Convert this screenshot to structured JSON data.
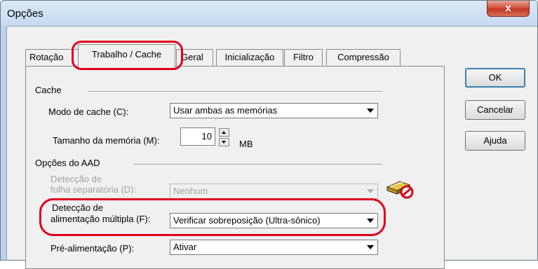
{
  "window": {
    "title": "Opções",
    "close_label": "x"
  },
  "tabs": [
    {
      "label": "Rotação"
    },
    {
      "label": "Trabalho / Cache"
    },
    {
      "label": "Geral"
    },
    {
      "label": "Inicialização"
    },
    {
      "label": "Filtro"
    },
    {
      "label": "Compressão"
    }
  ],
  "cache": {
    "heading": "Cache",
    "mode_label": "Modo de cache (C):",
    "mode_value": "Usar ambas as memórias",
    "memory_label": "Tamanho da memória (M):",
    "memory_value": "10",
    "memory_unit": "MB"
  },
  "aad": {
    "heading": "Opções do AAD",
    "separator_label_1": "Detecção de",
    "separator_label_2": "folha separatória (D):",
    "separator_value": "Nenhum",
    "multifeed_label_1": "Detecção de",
    "multifeed_label_2": "alimentação múltipla (F):",
    "multifeed_value": "Verificar sobreposição (Ultra-sônico)",
    "prefeed_label": "Pré-alimentação (P):",
    "prefeed_value": "Ativar"
  },
  "buttons": {
    "ok": "OK",
    "cancel": "Cancelar",
    "help": "Ajuda"
  },
  "colors": {
    "highlight_ring": "#e0001b",
    "title_bar": "#c6daf0",
    "close_button": "#c1381f"
  }
}
